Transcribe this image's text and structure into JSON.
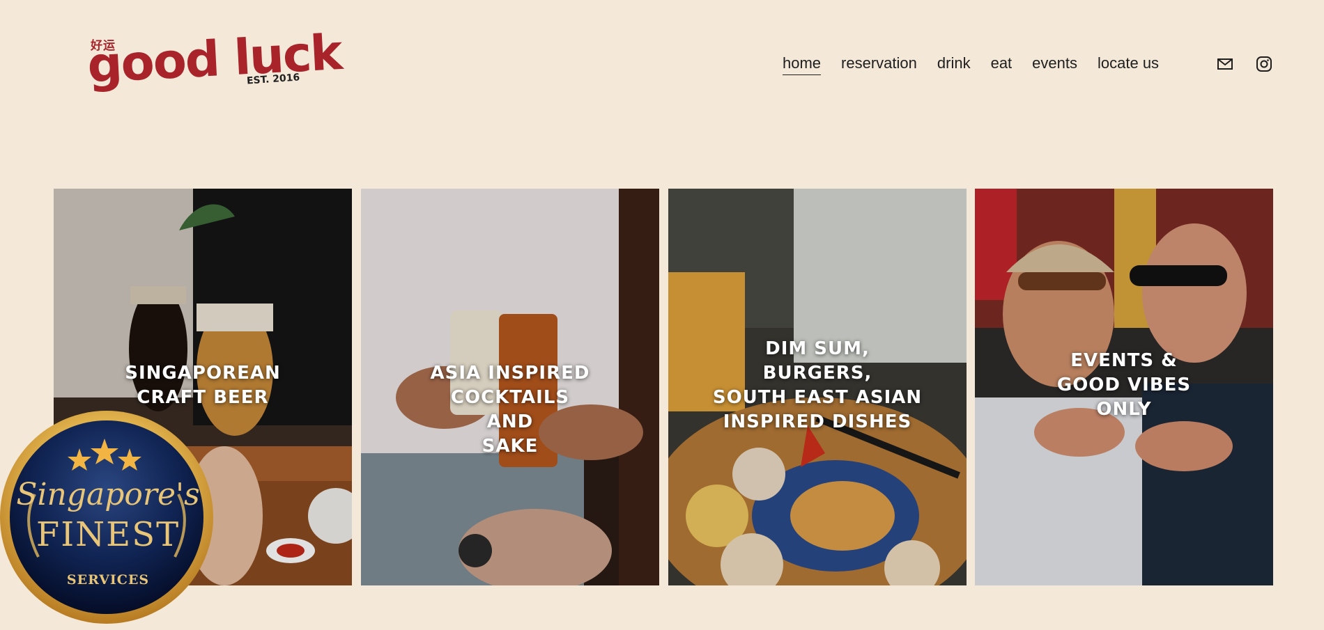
{
  "brand": {
    "chinese": "好运",
    "name": "good luck",
    "est": "EST. 2016",
    "color": "#a8232a"
  },
  "nav": {
    "items": [
      {
        "label": "home",
        "active": true
      },
      {
        "label": "reservation"
      },
      {
        "label": "drink"
      },
      {
        "label": "eat"
      },
      {
        "label": "events"
      },
      {
        "label": "locate us"
      }
    ]
  },
  "social": {
    "icons": [
      "email-icon",
      "instagram-icon"
    ]
  },
  "tiles": [
    {
      "caption": "SINGAPOREAN\nCRAFT BEER"
    },
    {
      "caption": "ASIA INSPIRED\nCOCKTAILS\nAND\nSAKE"
    },
    {
      "caption": "DIM SUM,\nBURGERS,\nSOUTH EAST ASIAN\nINSPIRED DISHES"
    },
    {
      "caption": "EVENTS &\nGOOD VIBES\nONLY"
    }
  ],
  "badge": {
    "line1": "Singapore's",
    "line2": "FINEST",
    "line3": "SERVICES",
    "stars": 3
  },
  "colors": {
    "background": "#f4e8d8",
    "text": "#1e1e1e",
    "badge_gold": "#e9c577",
    "badge_navy": "#0d1b3d"
  }
}
